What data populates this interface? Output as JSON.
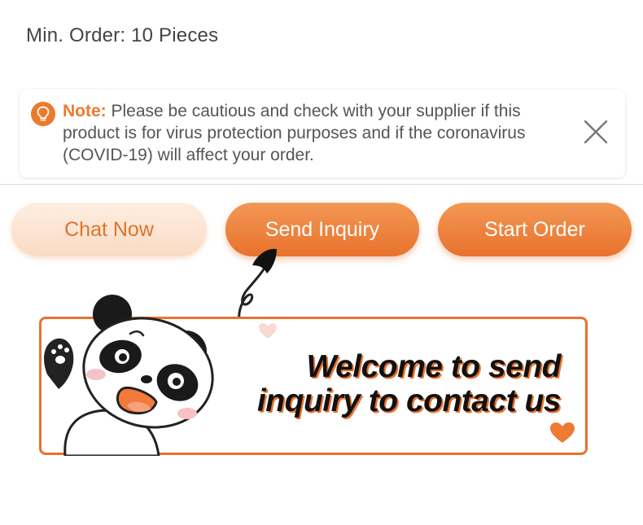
{
  "product": {
    "min_order": "Min. Order: 10 Pieces"
  },
  "note": {
    "label": "Note:",
    "message": " Please be cautious and check with your supplier if this product is for virus protection purposes and if the coronavirus (COVID-19) will affect your order.",
    "icon": "lightbulb-icon",
    "close_icon": "close-icon"
  },
  "actions": {
    "chat_label": "Chat Now",
    "send_label": "Send Inquiry",
    "order_label": "Start Order"
  },
  "banner": {
    "line1": "Welcome to send",
    "line2": "inquiry to contact us"
  },
  "colors": {
    "accent": "#e8722c",
    "chat_bg": "#fdeee2",
    "text_gray": "#555555"
  }
}
